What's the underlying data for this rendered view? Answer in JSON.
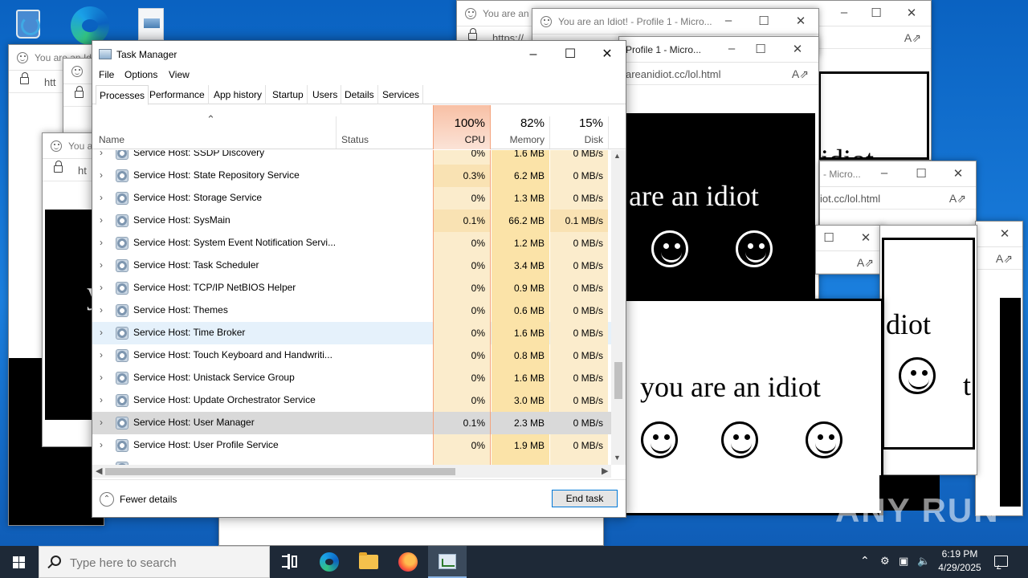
{
  "desktop": {
    "icons": [
      "recycle-bin-icon",
      "edge-icon",
      "document-icon"
    ]
  },
  "popups": {
    "title_short": "You are an Idio",
    "title_profile": "You are an Idiot! - Profile 1 - Micro...",
    "title_profile_cut": "Profile 1 - Micro...",
    "title_micro": "- Micro...",
    "url_prefix": "https://",
    "url_short": "htt",
    "url_mid": "ht",
    "url_full": "areanidiot.cc/lol.html",
    "url_end": "iot.cc/lol.html",
    "idiot_text": "you are an idiot",
    "are_text": "are an idiot",
    "idiot_fragment": "idiot",
    "dot_fragment": "diot",
    "y_fragment": "y",
    "t_fragment": "t"
  },
  "task_manager": {
    "title": "Task Manager",
    "menu": [
      "File",
      "Options",
      "View"
    ],
    "tabs": [
      "Processes",
      "Performance",
      "App history",
      "Startup",
      "Users",
      "Details",
      "Services"
    ],
    "active_tab": "Processes",
    "columns": {
      "name": "Name",
      "status": "Status",
      "cpu_pct": "100%",
      "cpu": "CPU",
      "mem_pct": "82%",
      "memory": "Memory",
      "disk_pct": "15%",
      "disk": "Disk"
    },
    "processes": [
      {
        "name": "Service Host: SSDP Discovery",
        "cpu": "0%",
        "memory": "1.6 MB",
        "disk": "0 MB/s"
      },
      {
        "name": "Service Host: State Repository Service",
        "cpu": "0.3%",
        "memory": "6.2 MB",
        "disk": "0 MB/s"
      },
      {
        "name": "Service Host: Storage Service",
        "cpu": "0%",
        "memory": "1.3 MB",
        "disk": "0 MB/s"
      },
      {
        "name": "Service Host: SysMain",
        "cpu": "0.1%",
        "memory": "66.2 MB",
        "disk": "0.1 MB/s"
      },
      {
        "name": "Service Host: System Event Notification Servi...",
        "cpu": "0%",
        "memory": "1.2 MB",
        "disk": "0 MB/s"
      },
      {
        "name": "Service Host: Task Scheduler",
        "cpu": "0%",
        "memory": "3.4 MB",
        "disk": "0 MB/s"
      },
      {
        "name": "Service Host: TCP/IP NetBIOS Helper",
        "cpu": "0%",
        "memory": "0.9 MB",
        "disk": "0 MB/s"
      },
      {
        "name": "Service Host: Themes",
        "cpu": "0%",
        "memory": "0.6 MB",
        "disk": "0 MB/s"
      },
      {
        "name": "Service Host: Time Broker",
        "cpu": "0%",
        "memory": "1.6 MB",
        "disk": "0 MB/s"
      },
      {
        "name": "Service Host: Touch Keyboard and Handwriti...",
        "cpu": "0%",
        "memory": "0.8 MB",
        "disk": "0 MB/s"
      },
      {
        "name": "Service Host: Unistack Service Group",
        "cpu": "0%",
        "memory": "1.6 MB",
        "disk": "0 MB/s"
      },
      {
        "name": "Service Host: Update Orchestrator Service",
        "cpu": "0%",
        "memory": "3.0 MB",
        "disk": "0 MB/s"
      },
      {
        "name": "Service Host: User Manager",
        "cpu": "0.1%",
        "memory": "2.3 MB",
        "disk": "0 MB/s"
      },
      {
        "name": "Service Host: User Profile Service",
        "cpu": "0%",
        "memory": "1.9 MB",
        "disk": "0 MB/s"
      }
    ],
    "hover_row": 8,
    "selected_row": 12,
    "fewer_details": "Fewer details",
    "end_task": "End task",
    "colors": {
      "cpu_cell": "#fbeccc",
      "cpu_cell_alt": "#f9e2b3",
      "mem_cell": "#fbe3a8",
      "cpu_border": "#f4a37d"
    }
  },
  "taskbar": {
    "search_placeholder": "Type here to search",
    "time": "6:19 PM",
    "date": "4/29/2025"
  },
  "watermark": "ANY RUN"
}
